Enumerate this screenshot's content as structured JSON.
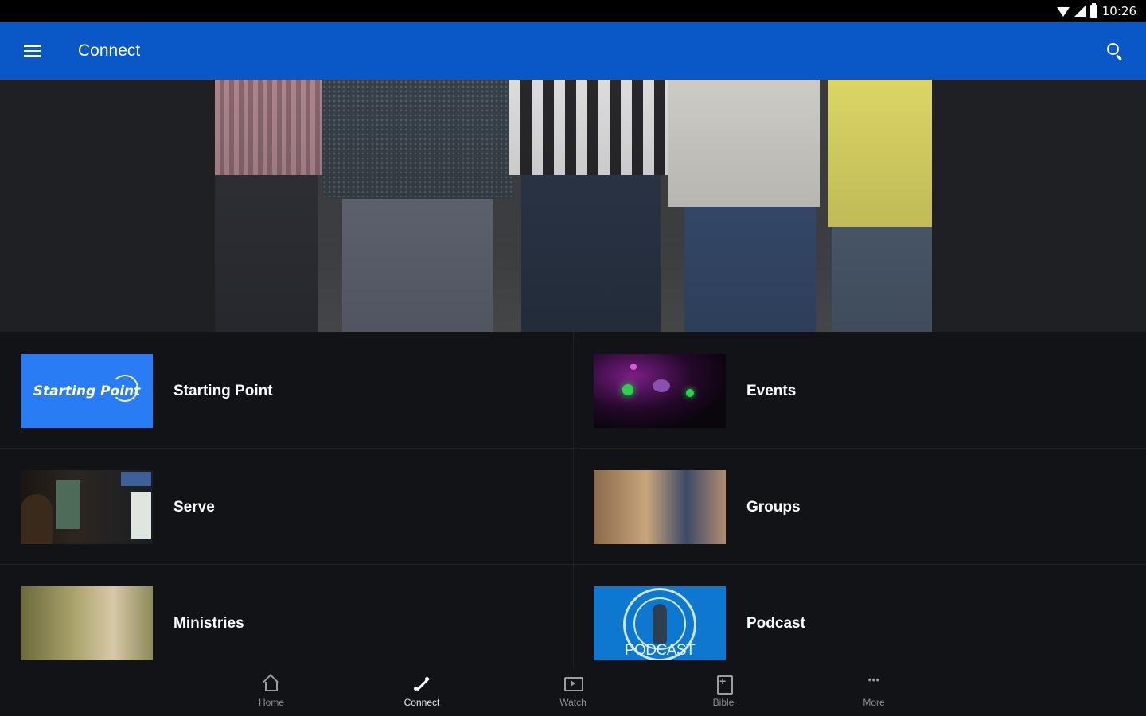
{
  "status_bar": {
    "time": "10:26"
  },
  "app_bar": {
    "title": "Connect"
  },
  "tiles": [
    {
      "label": "Starting Point",
      "thumb_text": "Starting Point"
    },
    {
      "label": "Events"
    },
    {
      "label": "Serve"
    },
    {
      "label": "Groups"
    },
    {
      "label": "Ministries"
    },
    {
      "label": "Podcast",
      "thumb_text": "PODCAST"
    }
  ],
  "bottom_nav": [
    {
      "label": "Home",
      "icon": "home-icon"
    },
    {
      "label": "Connect",
      "icon": "connect-icon",
      "active": true
    },
    {
      "label": "Watch",
      "icon": "watch-icon"
    },
    {
      "label": "Bible",
      "icon": "bible-icon"
    },
    {
      "label": "More",
      "icon": "more-icon"
    }
  ],
  "colors": {
    "app_bar": "#0a58c7",
    "background": "#111317",
    "starting_point_thumb": "#2a7cf5",
    "podcast_thumb": "#0e77cf"
  }
}
